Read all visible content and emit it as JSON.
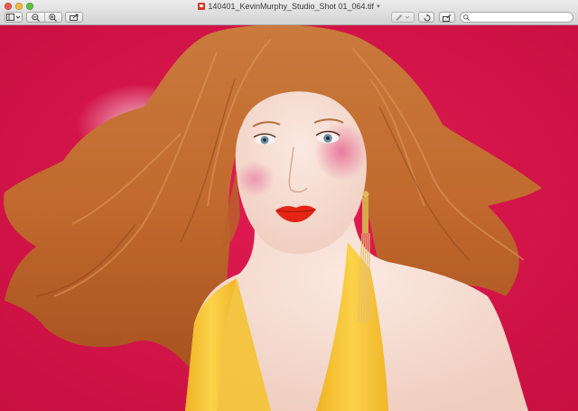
{
  "window": {
    "title": "140401_KevinMurphy_Studio_Shot 01_064.tif",
    "title_chevron": "▾",
    "file_icon": "tiff-file-icon"
  },
  "toolbar": {
    "buttons": [
      {
        "name": "sidebar-view-button",
        "icon": "sidebar-icon"
      },
      {
        "name": "zoom-out-button",
        "icon": "zoom-out-icon"
      },
      {
        "name": "zoom-in-button",
        "icon": "zoom-in-icon"
      },
      {
        "name": "share-button",
        "icon": "share-icon"
      },
      {
        "name": "annotate-button",
        "icon": "pen-icon"
      },
      {
        "name": "rotate-button",
        "icon": "rotate-icon"
      },
      {
        "name": "edit-toolbar-button",
        "icon": "toolbox-icon"
      }
    ],
    "search_placeholder": ""
  },
  "colors": {
    "background": "#d5154a",
    "hair": "#c46f35",
    "skin": "#f4dcd0",
    "dress": "#f6c02e",
    "lips": "#e42516"
  },
  "image": {
    "subject": "studio portrait photograph"
  }
}
